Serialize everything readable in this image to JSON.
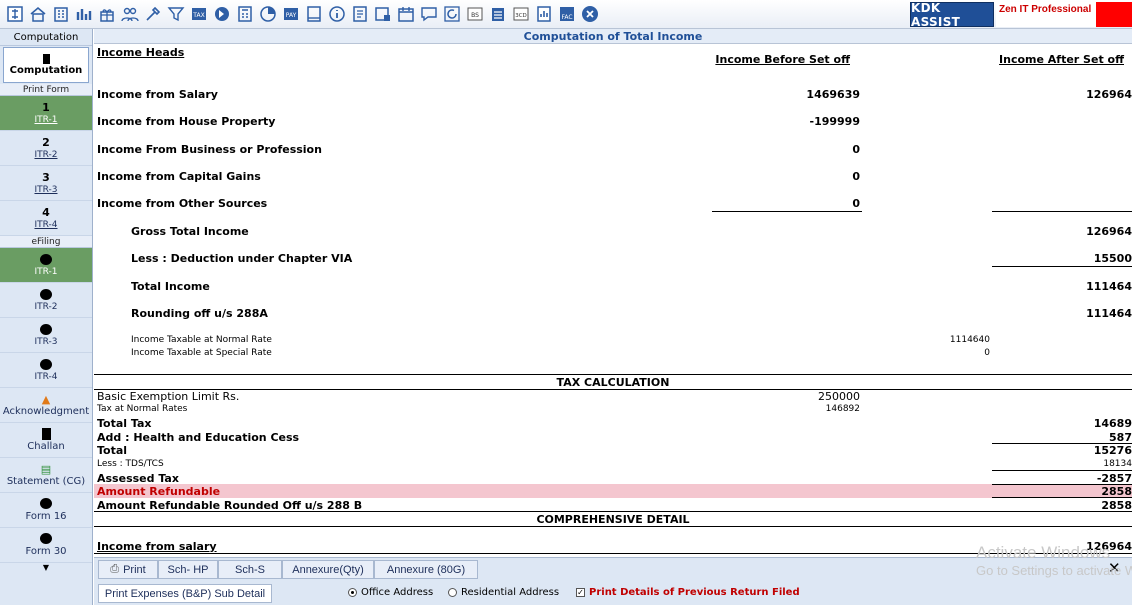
{
  "toolbar": {
    "icons": [
      "home-icon",
      "building-icon",
      "bar-chart-icon",
      "gift-icon",
      "people-icon",
      "tools-icon",
      "filter-icon",
      "tax-icon",
      "forward-icon",
      "calculator-icon",
      "pie-icon",
      "pay-icon",
      "book-icon",
      "info-icon",
      "form-icon",
      "image-icon",
      "calendar-icon",
      "chat-icon",
      "refresh-icon",
      "bs-icon",
      "stack-icon",
      "3cd-icon",
      "report-icon",
      "fac-icon",
      "close-icon"
    ],
    "kdk_label": "KDK ASSIST",
    "zen_label": "Zen IT Professional",
    "tax_badge": "TAX",
    "pay_badge": "PAY",
    "bs_badge": "BS",
    "cd_badge": "3CD",
    "fac_badge": "FAC"
  },
  "sidebar": {
    "computation_section": "Computation",
    "computation_button": "Computation",
    "print_form_section": "Print Form",
    "print_items": [
      {
        "num": "1",
        "label": "ITR-1"
      },
      {
        "num": "2",
        "label": "ITR-2"
      },
      {
        "num": "3",
        "label": "ITR-3"
      },
      {
        "num": "4",
        "label": "ITR-4"
      }
    ],
    "efiling_section": "eFiling",
    "efiling_items": [
      "ITR-1",
      "ITR-2",
      "ITR-3",
      "ITR-4"
    ],
    "misc": [
      "Acknowledgment",
      "Challan",
      "Statement (CG)",
      "Form 16",
      "Form 30"
    ]
  },
  "main": {
    "title": "Computation of Total Income",
    "col_heads": "Income Heads",
    "col_before": "Income Before Set off",
    "col_after": "Income After Set off",
    "rows": [
      {
        "label": "Income from Salary",
        "before": "1469639",
        "after": "126964"
      },
      {
        "label": "Income from House Property",
        "before": "-199999",
        "after": ""
      },
      {
        "label": "Income From Business or Profession",
        "before": "0",
        "after": ""
      },
      {
        "label": "Income from Capital Gains",
        "before": "0",
        "after": ""
      },
      {
        "label": "Income from Other Sources",
        "before": "0",
        "after": ""
      }
    ],
    "gross_total_label": "Gross Total Income",
    "gross_total": "126964",
    "deduction_label": "Less : Deduction under Chapter VIA",
    "deduction": "15500",
    "total_income_label": "Total Income",
    "total_income": "111464",
    "rounding_label": "Rounding off u/s 288A",
    "rounding": "111464",
    "normal_rate_label": "Income Taxable at Normal Rate",
    "normal_rate": "1114640",
    "special_rate_label": "Income Taxable at Special Rate",
    "special_rate": "0",
    "tax_calc_title": "TAX CALCULATION",
    "basic_exemption_label": "Basic Exemption Limit Rs.",
    "basic_exemption": "250000",
    "tax_normal_label": "Tax at Normal Rates",
    "tax_normal": "146892",
    "total_tax_label": "Total Tax",
    "total_tax": "14689",
    "cess_label": "Add : Health and Education Cess",
    "cess": "587",
    "total_label": "Total",
    "total": "15276",
    "tds_label": "Less : TDS/TCS",
    "tds": "18134",
    "assessed_label": "Assessed Tax",
    "assessed": "-2857",
    "refundable_label": "Amount Refundable",
    "refundable": "2858",
    "refund_rounded_label": "Amount Refundable Rounded Off u/s 288 B",
    "refund_rounded": "2858",
    "comprehensive_title": "COMPREHENSIVE DETAIL",
    "income_salary_label": "Income from salary",
    "income_salary": "126964"
  },
  "bottom": {
    "tabs": [
      "Print",
      "Sch- HP",
      "Sch-S",
      "Annexure(Qty)",
      "Annexure (80G)"
    ],
    "sub_tab": "Print Expenses (B&P) Sub Detail",
    "radio_office": "Office Address",
    "radio_residential": "Residential Address",
    "check_prev": "Print Details of Previous Return Filed"
  },
  "watermark": {
    "line1": "Activate Windows",
    "line2": "Go to Settings to activate Windows."
  }
}
